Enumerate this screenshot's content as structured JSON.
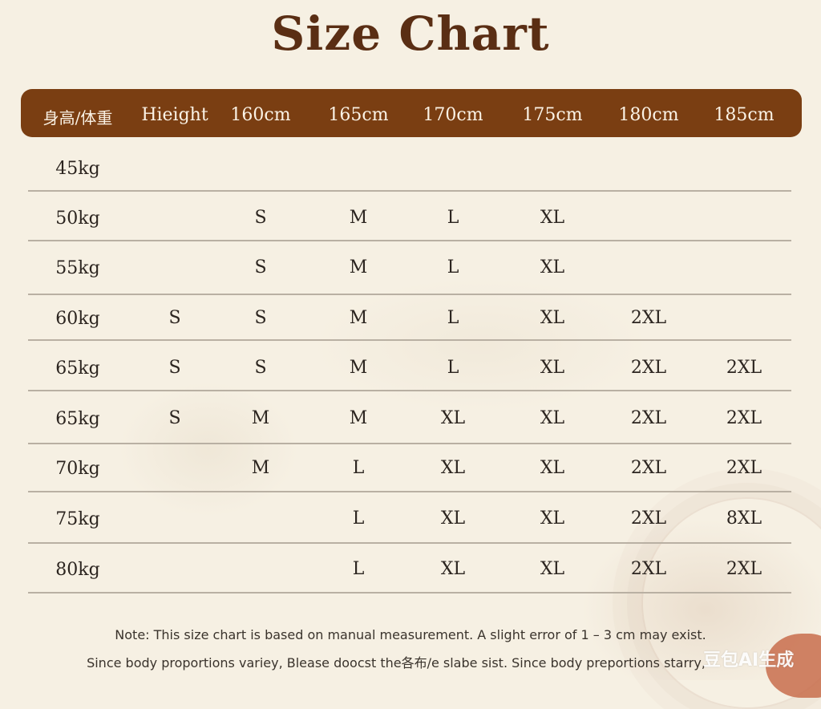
{
  "title": "Size Chart",
  "header": [
    "身高/体重",
    "Hieight",
    "160cm",
    "165cm",
    "170cm",
    "175cm",
    "180cm",
    "185cm"
  ],
  "rows": [
    {
      "weight": "45kg",
      "sizes": [
        "",
        "",
        "",
        "",
        "",
        "",
        ""
      ]
    },
    {
      "weight": "50kg",
      "sizes": [
        "",
        "S",
        "M",
        "L",
        "XL",
        "",
        ""
      ]
    },
    {
      "weight": "55kg",
      "sizes": [
        "",
        "S",
        "M",
        "L",
        "XL",
        "",
        ""
      ]
    },
    {
      "weight": "60kg",
      "sizes": [
        "S",
        "S",
        "M",
        "L",
        "XL",
        "2XL",
        ""
      ]
    },
    {
      "weight": "65kg",
      "sizes": [
        "S",
        "S",
        "M",
        "L",
        "XL",
        "2XL",
        "2XL"
      ]
    },
    {
      "weight": "65kg",
      "sizes": [
        "S",
        "M",
        "M",
        "XL",
        "XL",
        "2XL",
        "2XL"
      ]
    },
    {
      "weight": "70kg",
      "sizes": [
        "",
        "M",
        "L",
        "XL",
        "XL",
        "2XL",
        "2XL"
      ]
    },
    {
      "weight": "75kg",
      "sizes": [
        "",
        "",
        "L",
        "XL",
        "XL",
        "2XL",
        "8XL"
      ]
    },
    {
      "weight": "80kg",
      "sizes": [
        "",
        "",
        "L",
        "XL",
        "XL",
        "2XL",
        "2XL"
      ]
    }
  ],
  "note_line1": "Note: This size chart is based on manual measurement. A slight error of 1 – 3 cm may exist.",
  "note_line2": "Since body proportions variey, Blease doocst the各布/e slabe sist. Since body preportions starry,",
  "watermark": "豆包AI生成",
  "colors": {
    "header_bg": "#7a3e12",
    "title": "#5a2e14",
    "page_bg": "#f6f0e3"
  }
}
